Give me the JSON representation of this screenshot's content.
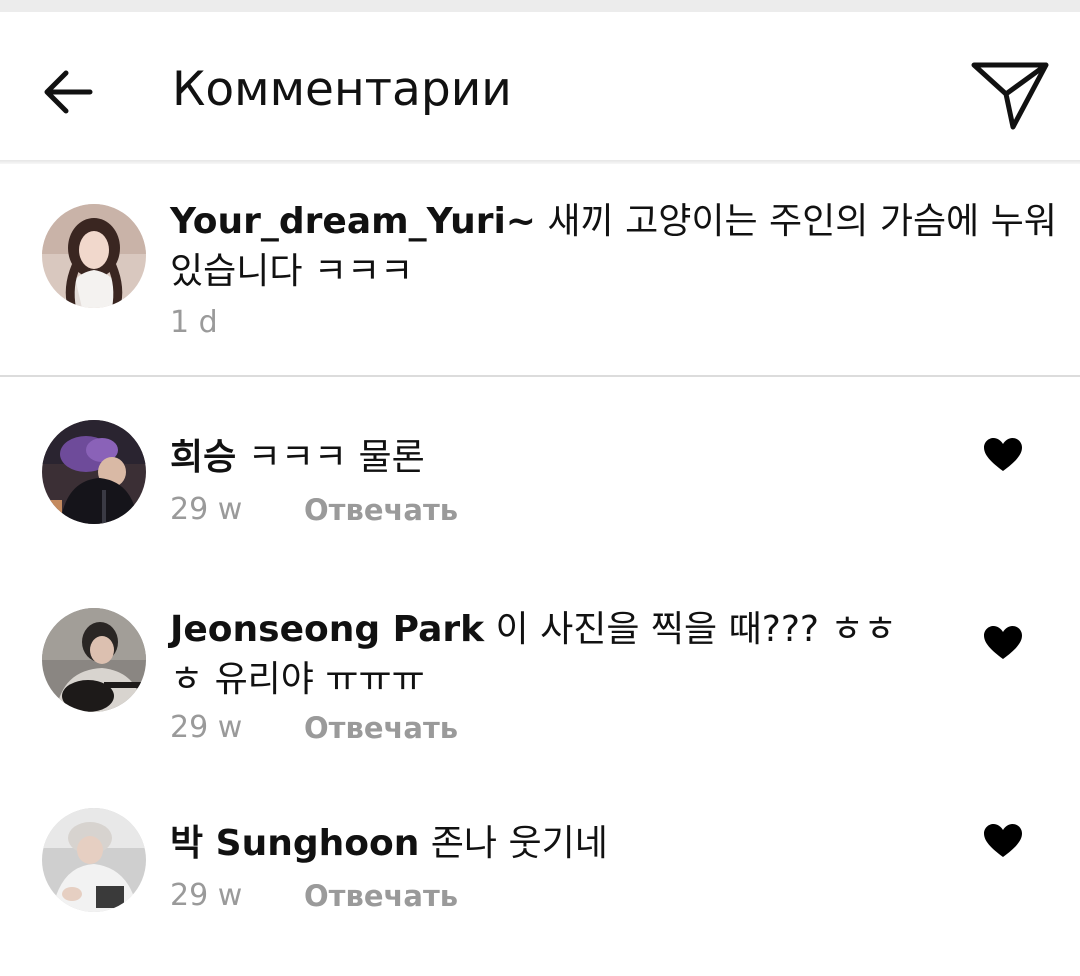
{
  "header": {
    "title": "Комментарии",
    "back_icon": "arrow-left-icon",
    "share_icon": "paper-plane-icon"
  },
  "caption": {
    "username": "Your_dream_Yuri~",
    "text_line1": " 새끼 고양이는 주인의 가슴에 누워",
    "text_line2": "있습니다 ㅋㅋㅋ",
    "time": "1 d"
  },
  "comments": [
    {
      "username": "희승",
      "text_line1": " ㅋㅋㅋ 물론",
      "text_line2": "",
      "time": "29 w",
      "reply_label": "Отвечать",
      "liked": true
    },
    {
      "username": "Jeonseong Park",
      "text_line1": " 이 사진을 찍을 때??? ㅎㅎ",
      "text_line2": "ㅎ 유리야 ㅠㅠㅠ",
      "time": "29 w",
      "reply_label": "Отвечать",
      "liked": true
    },
    {
      "username": "박 Sunghoon",
      "text_line1": " 존나 웃기네",
      "text_line2": "",
      "time": "29 w",
      "reply_label": "Отвечать",
      "liked": true
    }
  ],
  "colors": {
    "text": "#111111",
    "meta": "#9a9a9a",
    "divider": "#dcdcdc",
    "like": "#000000"
  }
}
